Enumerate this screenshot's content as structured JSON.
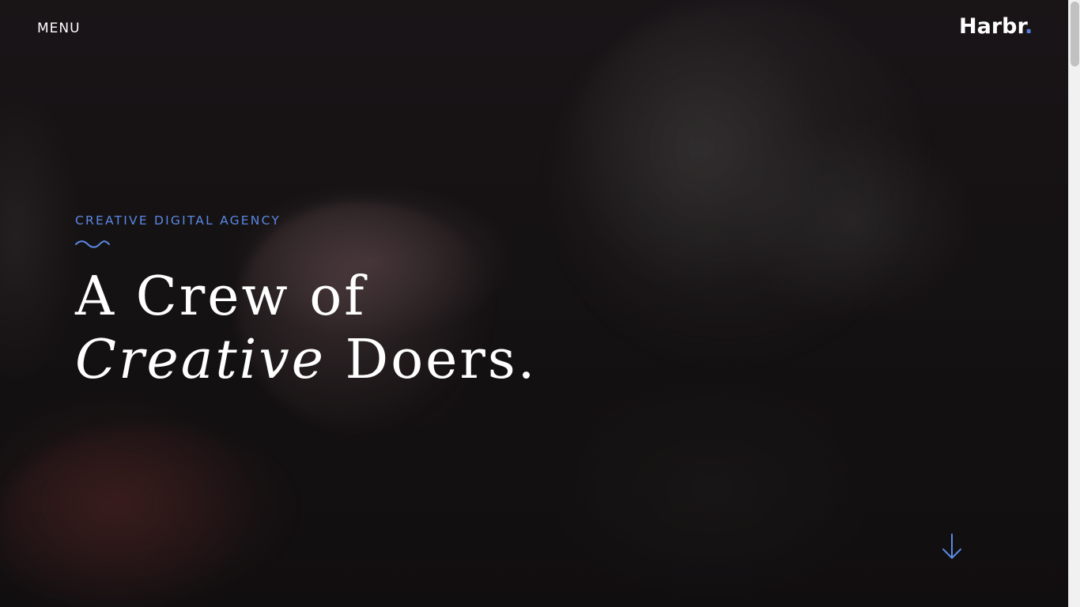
{
  "nav": {
    "menu_label": "MENU"
  },
  "brand": {
    "name": "Harbr",
    "dot": ".",
    "dot_color": "#4f7fe0"
  },
  "hero": {
    "eyebrow": "CREATIVE DIGITAL AGENCY",
    "headline_line1": "A Crew of",
    "headline_line2_italic": "Creative",
    "headline_line2_rest": " Doers.",
    "accent_color": "#5b88e3"
  },
  "icons": {
    "wave": "wave-divider-icon",
    "scroll": "arrow-down-icon"
  }
}
